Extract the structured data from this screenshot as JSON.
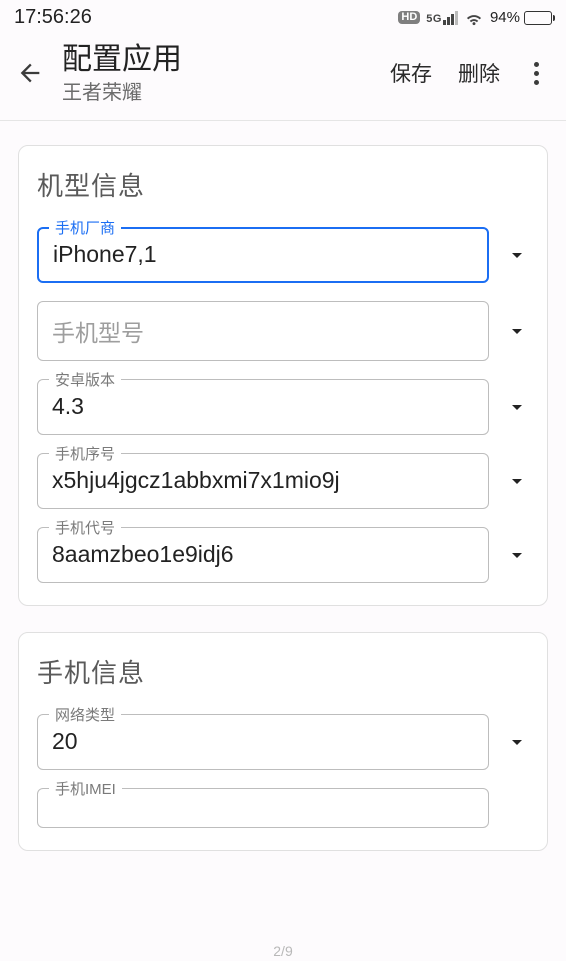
{
  "status_bar": {
    "time": "17:56:26",
    "hd": "HD",
    "network": "5G",
    "battery_pct": "94%"
  },
  "app_bar": {
    "title": "配置应用",
    "subtitle": "王者荣耀",
    "save": "保存",
    "delete": "删除"
  },
  "sections": {
    "device": {
      "heading": "机型信息",
      "manufacturer": {
        "label": "手机厂商",
        "value": "iPhone7,1"
      },
      "model": {
        "label": "手机型号",
        "value": "",
        "placeholder": "手机型号"
      },
      "android": {
        "label": "安卓版本",
        "value": "4.3"
      },
      "serial": {
        "label": "手机序号",
        "value": "x5hju4jgcz1abbxmi7x1mio9j"
      },
      "codename": {
        "label": "手机代号",
        "value": "8aamzbeo1e9idj6"
      }
    },
    "phone": {
      "heading": "手机信息",
      "nettype": {
        "label": "网络类型",
        "value": "20"
      },
      "imei": {
        "label": "手机IMEI",
        "value": ""
      }
    }
  },
  "pager": "2/9"
}
